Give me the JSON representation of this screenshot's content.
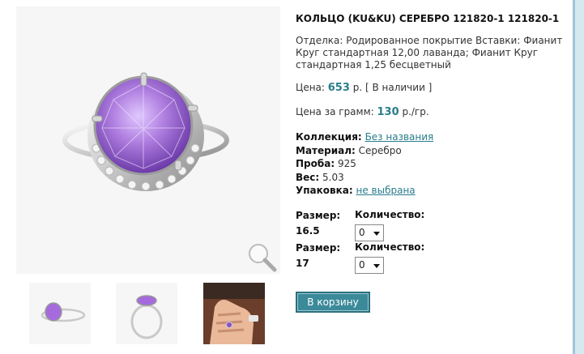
{
  "product": {
    "title": "КОЛЬЦО (KU&KU) СЕРЕБРО 121820-1 121820-1",
    "finish": "Отделка: Родированное покрытие Вставки: Фианит Круг стандартная 12,00 лаванда; Фианит Круг стандартная 1,25 бесцветный",
    "price_label": "Цена: ",
    "price_value": "653",
    "price_suffix": " р. [ В наличии ]",
    "gram_label": "Цена за грамм: ",
    "gram_value": "130",
    "gram_suffix": " р./гр."
  },
  "props": {
    "collection_label": "Коллекция:",
    "collection_value": "Без названия",
    "material_label": "Материал:",
    "material_value": " Серебро",
    "proba_label": "Проба:",
    "proba_value": " 925",
    "weight_label": "Вес:",
    "weight_value": " 5.03",
    "package_label": "Упаковка:",
    "package_value": "не выбрана"
  },
  "sizes": [
    {
      "size_label": "Размер:",
      "size_value": "16.5",
      "qty_label": "Количество:",
      "qty_value": "0"
    },
    {
      "size_label": "Размер:",
      "size_value": "17",
      "qty_label": "Количество:",
      "qty_value": "0"
    }
  ],
  "cart_button": "В корзину",
  "icons": {
    "zoom": "magnifier-icon"
  },
  "colors": {
    "accent": "#2a7d8c",
    "button": "#3b8a9a",
    "gem": "#b07fe0"
  }
}
